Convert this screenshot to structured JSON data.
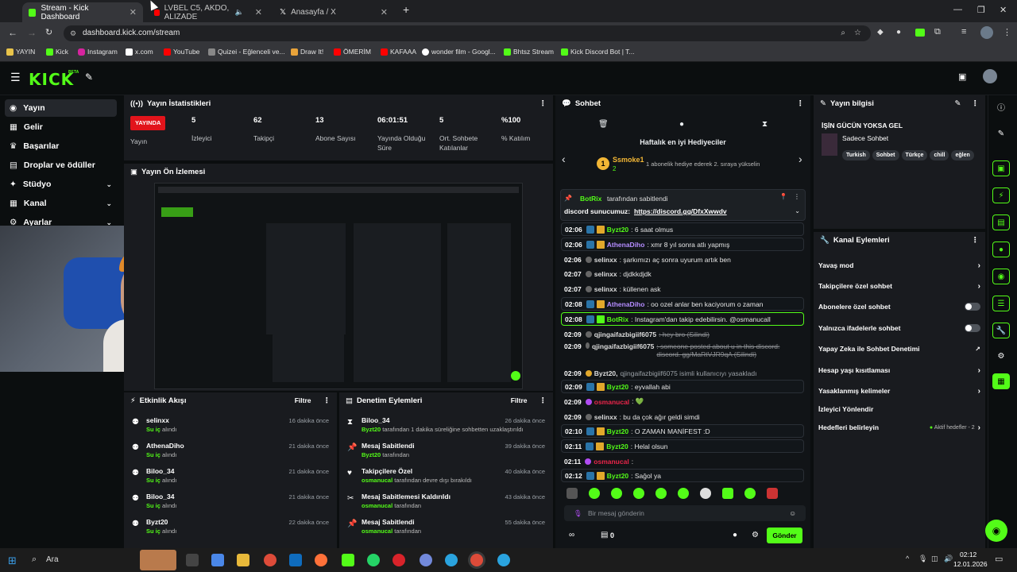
{
  "browser": {
    "tabs": [
      {
        "label": "Stream - Kick Dashboard",
        "active": true
      },
      {
        "label": "LVBEL C5, AKDO, ALIZADE",
        "active": false
      },
      {
        "label": "Anasayfa / X",
        "active": false
      }
    ],
    "url": "dashboard.kick.com/stream",
    "bookmarks": [
      "YAYIN",
      "Kick",
      "Instagram",
      "x.com",
      "YouTube",
      "Quizei - Eğlenceli ve...",
      "Draw It!",
      "ÖMERİM",
      "KAFAAA",
      "wonder film - Googl...",
      "Bhtsz Stream",
      "Kick Discord Bot | T..."
    ]
  },
  "header": {
    "logo": "KICK",
    "beta": "BETA"
  },
  "sidebar": {
    "items": [
      {
        "label": "Yayın",
        "active": true
      },
      {
        "label": "Gelir"
      },
      {
        "label": "Başarılar"
      },
      {
        "label": "Droplar ve ödüller"
      },
      {
        "label": "Stüdyo",
        "expand": true
      },
      {
        "label": "Kanal",
        "expand": true
      },
      {
        "label": "Ayarlar",
        "expand": true
      }
    ]
  },
  "stats": {
    "title": "Yayın İstatistikleri",
    "live_label": "YAYINDA",
    "items": [
      {
        "value": "5",
        "label": "İzleyici"
      },
      {
        "value": "62",
        "label": "Takipçi"
      },
      {
        "value": "13",
        "label": "Abone Sayısı"
      },
      {
        "value": "06:01:51",
        "label": "Yayında Olduğu Süre"
      },
      {
        "value": "5",
        "label": "Ort. Sohbete Katılanlar"
      },
      {
        "value": "%100",
        "label": "% Katılım"
      }
    ],
    "yayin": "Yayın"
  },
  "preview": {
    "title": "Yayın Ön İzlemesi"
  },
  "activity": {
    "title": "Etkinlik Akışı",
    "filter": "Filtre",
    "items": [
      {
        "user": "selinxx",
        "action": "Su iç",
        "suffix": "alındı",
        "time": "16 dakika önce"
      },
      {
        "user": "AthenaDiho",
        "action": "Su iç",
        "suffix": "alındı",
        "time": "21 dakika önce"
      },
      {
        "user": "Biloo_34",
        "action": "Su iç",
        "suffix": "alındı",
        "time": "21 dakika önce"
      },
      {
        "user": "Biloo_34",
        "action": "Su iç",
        "suffix": "alındı",
        "time": "21 dakika önce"
      },
      {
        "user": "Byzt20",
        "action": "Su iç",
        "suffix": "alındı",
        "time": "22 dakika önce"
      }
    ]
  },
  "moderation": {
    "title": "Denetim Eylemleri",
    "filter": "Filtre",
    "items": [
      {
        "title": "Biloo_34",
        "actor": "Byzt20",
        "desc": "tarafından 1 dakika süreliğine sohbetten uzaklaştırıldı",
        "time": "26 dakika önce"
      },
      {
        "title": "Mesaj Sabitlendi",
        "actor": "Byzt20",
        "desc": "tarafından",
        "time": "39 dakika önce"
      },
      {
        "title": "Takipçilere Özel",
        "actor": "osmanucal",
        "desc": "tarafından devre dışı bırakıldı",
        "time": "40 dakika önce"
      },
      {
        "title": "Mesaj Sabitlemesi Kaldırıldı",
        "actor": "osmanucal",
        "desc": "tarafından",
        "time": "43 dakika önce"
      },
      {
        "title": "Mesaj Sabitlendi",
        "actor": "osmanucal",
        "desc": "tarafından",
        "time": "55 dakika önce"
      }
    ]
  },
  "chat": {
    "title": "Sohbet",
    "gifters_title": "Haftalık en iyi Hediyeciler",
    "top_gifter": {
      "rank": "1",
      "name": "Ssmoke1",
      "count": "2"
    },
    "gifter_hint": "1 abonelik hediye ederek 2. sıraya yükselin",
    "pinned_by": "BotRix",
    "pinned_suffix": "tarafından sabitlendi",
    "pinned_text": "discord sunucumuz:",
    "pinned_link": "https://discord.gg/DfxXwwdv",
    "messages": [
      {
        "t": "02:06",
        "user": "Byzt20",
        "color": "#53fc18",
        "text": ": 6 saat olmus",
        "hl": true
      },
      {
        "t": "02:06",
        "user": "AthenaDiho",
        "color": "#b48cff",
        "text": ": xmr 8 yıl sonra atlı yapmış",
        "hl": true
      },
      {
        "t": "02:06",
        "user": "selinxx",
        "color": "#dddddd",
        "text": ": şarkımızı aç sonra uyurum artık ben"
      },
      {
        "t": "02:07",
        "user": "selinxx",
        "color": "#dddddd",
        "text": ": djdkkdjdk"
      },
      {
        "t": "02:07",
        "user": "selinxx",
        "color": "#dddddd",
        "text": ": küllenen ask"
      },
      {
        "t": "02:08",
        "user": "AthenaDiho",
        "color": "#b48cff",
        "text": ": oo ozel anlar ben kaciyorum o zaman",
        "hl": true
      },
      {
        "t": "02:08",
        "user": "BotRix",
        "color": "#53fc18",
        "text": ": Instagram'dan takip edebilirsin. @osmanucall",
        "hlg": true
      },
      {
        "t": "02:09",
        "user": "qjingaifazbigiif6075",
        "color": "#dddddd",
        "text": ": hey bro (Silindi)",
        "strike": true
      },
      {
        "t": "02:09",
        "user": "qjingaifazbigiif6075",
        "color": "#dddddd",
        "text": ": someone posted about u in this discord: discord. gg/MaRtVJR9qA (Silindi)",
        "strike": true
      },
      {
        "t": "02:09",
        "user": "Byzt20,",
        "color": "#dddddd",
        "text": "qjingaifazbigiif6075 isimli kullanıcıyı yasakladı",
        "sys": true
      },
      {
        "t": "02:09",
        "user": "Byzt20",
        "color": "#53fc18",
        "text": ": eyvallah abi",
        "hl": true
      },
      {
        "t": "02:09",
        "user": "osmanucal",
        "color": "#e9254a",
        "text": ": 💚"
      },
      {
        "t": "02:09",
        "user": "selinxx",
        "color": "#dddddd",
        "text": ": bu da çok ağır geldi simdi"
      },
      {
        "t": "02:10",
        "user": "Byzt20",
        "color": "#53fc18",
        "text": ": O ZAMAN MANİFEST :D",
        "hl": true
      },
      {
        "t": "02:11",
        "user": "Byzt20",
        "color": "#53fc18",
        "text": ": Helal olsun",
        "hl": true
      },
      {
        "t": "02:11",
        "user": "osmanucal",
        "color": "#e9254a",
        "text": ":"
      },
      {
        "t": "02:12",
        "user": "Byzt20",
        "color": "#53fc18",
        "text": ": Sağol ya",
        "hl": true
      }
    ],
    "input_placeholder": "Bir mesaj gönderin",
    "send_label": "Gönder",
    "points": "0"
  },
  "stream_info": {
    "title": "Yayın bilgisi",
    "stream_title": "İŞİN GÜCÜN YOKSA GEL",
    "category": "Sadece Sohbet",
    "tags": [
      "Turkish",
      "Sohbet",
      "Türkçe",
      "chill",
      "eğlen"
    ]
  },
  "channel_actions": {
    "title": "Kanal Eylemleri",
    "items": [
      {
        "label": "Yavaş mod",
        "type": "arrow"
      },
      {
        "label": "Takipçilere özel sohbet",
        "type": "arrow"
      },
      {
        "label": "Abonelere özel sohbet",
        "type": "toggle"
      },
      {
        "label": "Yalnızca ifadelerle sohbet",
        "type": "toggle"
      },
      {
        "label": "Yapay Zeka ile Sohbet Denetimi",
        "type": "link"
      },
      {
        "label": "Hesap yaşı kısıtlaması",
        "type": "arrow"
      },
      {
        "label": "Yasaklanmış kelimeler",
        "type": "arrow"
      },
      {
        "label": "İzleyici Yönlendir",
        "type": "none"
      },
      {
        "label": "Hedefleri belirleyin",
        "type": "arrow",
        "extra": "Aktif hedefler - 2"
      }
    ]
  },
  "taskbar": {
    "search": "Ara",
    "time": "02:12",
    "date": "12.01.2026"
  },
  "colors": {
    "accent": "#53fc18",
    "live": "#e2141b",
    "panel": "#191b1f"
  }
}
